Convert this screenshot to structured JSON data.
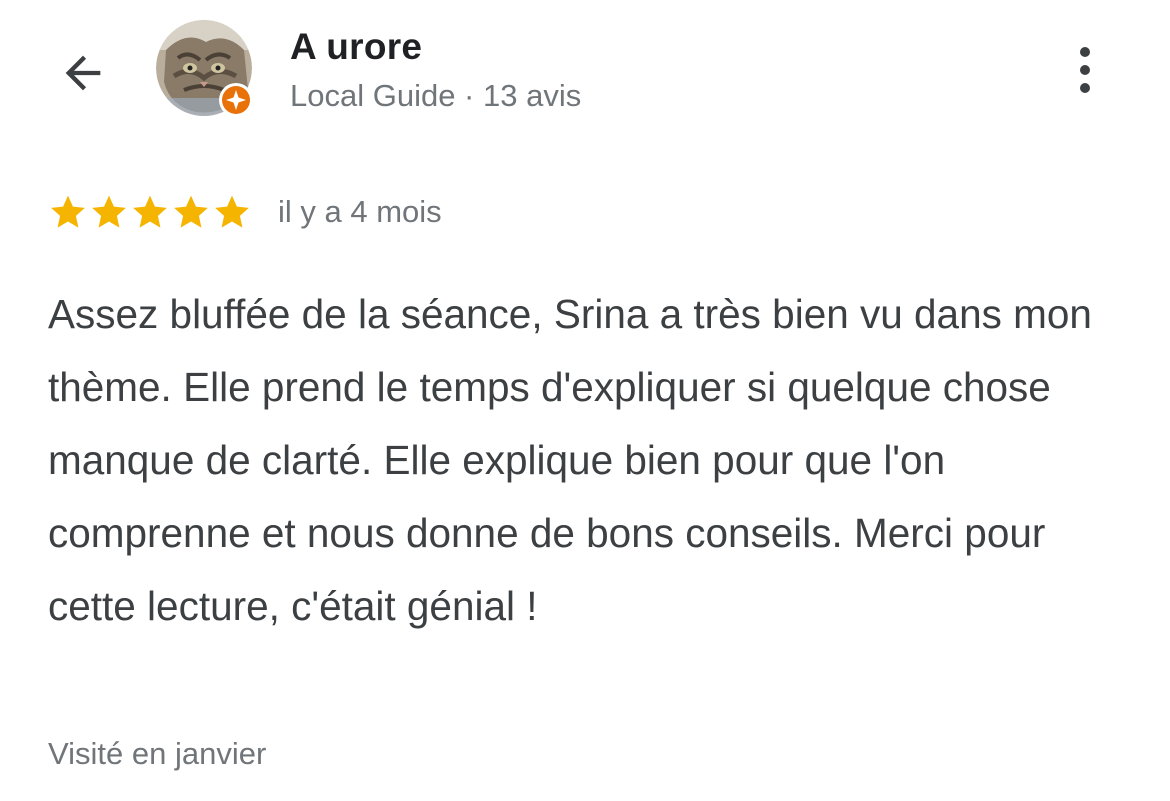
{
  "header": {
    "back_icon": "arrow-left-icon",
    "author_name": "A urore",
    "author_meta": "Local Guide · 13 avis",
    "avatar_icon": "cat-photo-avatar",
    "badge_icon": "local-guide-star-badge-icon",
    "menu_icon": "more-vertical-icon"
  },
  "review": {
    "rating": 5,
    "rating_max": 5,
    "star_color": "#f4b400",
    "date": "il y a 4 mois",
    "text": "Assez bluffée de la séance, Srina a très bien vu dans mon thème. Elle prend le temps d'expliquer si quelque chose manque de clarté. Elle explique bien pour que l'on comprenne et nous donne de bons conseils. Merci pour cette lecture, c'était génial !",
    "visit": "Visité en janvier"
  },
  "colors": {
    "badge_orange": "#e8710a",
    "text_primary": "#202124",
    "text_secondary": "#70757a",
    "body_text": "#3c4043"
  }
}
